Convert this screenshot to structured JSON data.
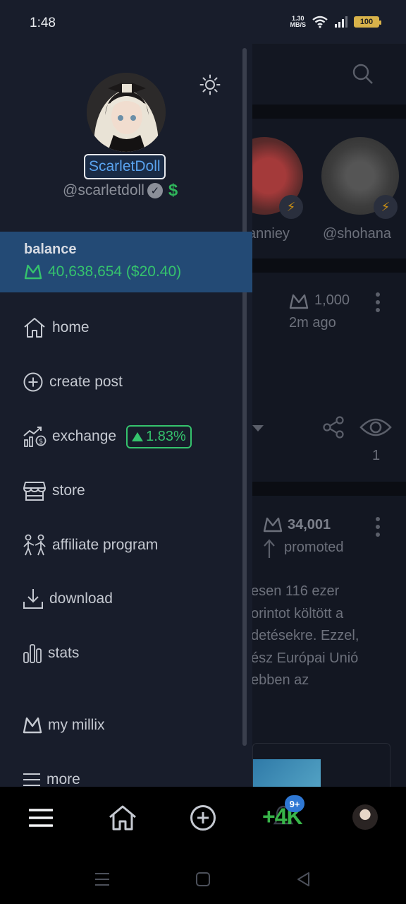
{
  "status_bar": {
    "time": "1:48",
    "net_speed_value": "1.30",
    "net_speed_unit": "MB/S",
    "battery": "100"
  },
  "drawer": {
    "display_name": "ScarletDoll",
    "handle": "@scarletdoll",
    "balance": {
      "label": "balance",
      "amount": "40,638,654 ($20.40)"
    },
    "menu": [
      {
        "label": "home",
        "icon": "home-icon"
      },
      {
        "label": "create post",
        "icon": "plus-circle-icon"
      },
      {
        "label": "exchange",
        "icon": "exchange-chart-icon",
        "badge": "1.83%"
      },
      {
        "label": "store",
        "icon": "store-icon"
      },
      {
        "label": "affiliate program",
        "icon": "affiliate-icon"
      },
      {
        "label": "download",
        "icon": "download-icon"
      },
      {
        "label": "stats",
        "icon": "bar-chart-icon"
      },
      {
        "label": "my millix",
        "icon": "millix-logo-icon"
      },
      {
        "label": "more",
        "icon": "hamburger-icon"
      }
    ]
  },
  "feed": {
    "stories": [
      {
        "name": "anniey"
      },
      {
        "name": "@shohana"
      }
    ],
    "post1": {
      "amount": "1,000",
      "time": "2m ago",
      "views": "1"
    },
    "post2": {
      "amount": "34,001",
      "status": "promoted",
      "text_lines": [
        "esen 116 ezer",
        "orintot költött a",
        "detésekre. Ezzel,",
        "ész Európai Unió",
        "ebben az"
      ]
    }
  },
  "bottom_nav": {
    "notification_badge": "9+",
    "label_4k": "+4K"
  },
  "colors": {
    "drawer_bg": "#181d2b",
    "balance_bg": "#234a75",
    "accent_green": "#35c36d",
    "link_blue": "#5aa3ef"
  }
}
